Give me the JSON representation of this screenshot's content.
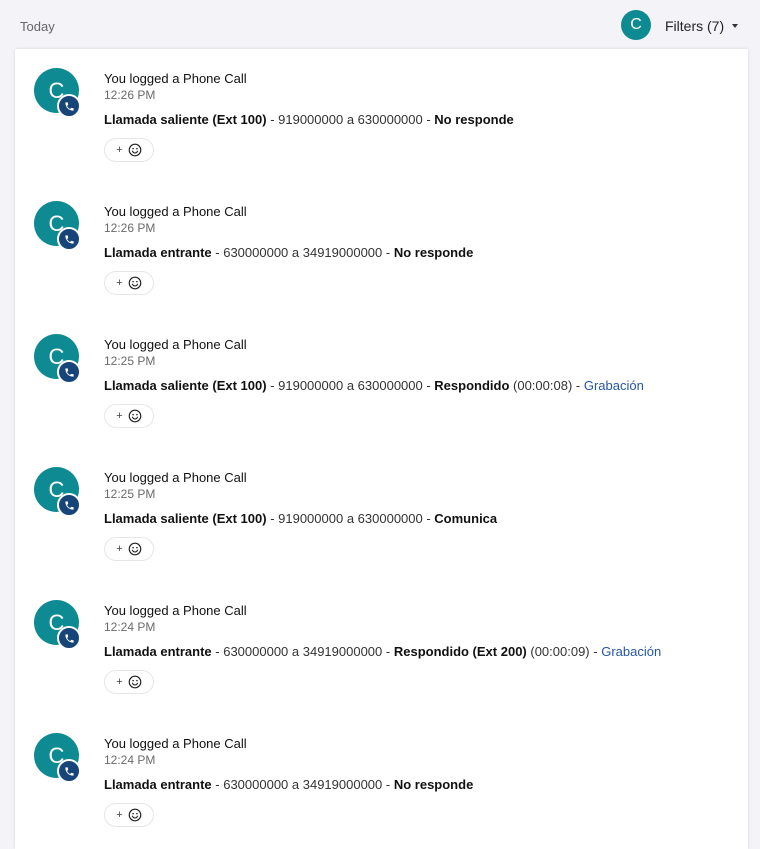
{
  "header": {
    "section_label": "Today",
    "avatar_initial": "C",
    "filters_label": "Filters (7)"
  },
  "colors": {
    "avatar": "#0e8a93",
    "phone_badge": "#17457a",
    "link": "#2456a6",
    "background": "#f4f3f7"
  },
  "icons": {
    "avatar": "avatar-icon",
    "phone": "phone-icon",
    "add": "plus-icon",
    "emoji": "smiley-icon",
    "filters": "caret-down-icon"
  },
  "activities": [
    {
      "avatar_initial": "C",
      "title": "You logged a Phone Call",
      "time": "12:26 PM",
      "call_type": "Llamada saliente (Ext 100)",
      "sep1": " - ",
      "numbers": "919000000 a 630000000",
      "sep2": " - ",
      "status": "No responde",
      "duration": "",
      "sep3": "",
      "recording": "",
      "react_plus": "+"
    },
    {
      "avatar_initial": "C",
      "title": "You logged a Phone Call",
      "time": "12:26 PM",
      "call_type": "Llamada entrante",
      "sep1": " - ",
      "numbers": "630000000 a 34919000000",
      "sep2": " - ",
      "status": "No responde",
      "duration": "",
      "sep3": "",
      "recording": "",
      "react_plus": "+"
    },
    {
      "avatar_initial": "C",
      "title": "You logged a Phone Call",
      "time": "12:25 PM",
      "call_type": "Llamada saliente (Ext 100)",
      "sep1": " - ",
      "numbers": "919000000 a 630000000",
      "sep2": " - ",
      "status": "Respondido",
      "duration": " (00:00:08)",
      "sep3": " - ",
      "recording": "Grabación",
      "react_plus": "+"
    },
    {
      "avatar_initial": "C",
      "title": "You logged a Phone Call",
      "time": "12:25 PM",
      "call_type": "Llamada saliente (Ext 100)",
      "sep1": " - ",
      "numbers": "919000000 a 630000000",
      "sep2": " - ",
      "status": "Comunica",
      "duration": "",
      "sep3": "",
      "recording": "",
      "react_plus": "+"
    },
    {
      "avatar_initial": "C",
      "title": "You logged a Phone Call",
      "time": "12:24 PM",
      "call_type": "Llamada entrante",
      "sep1": " - ",
      "numbers": "630000000 a 34919000000",
      "sep2": " - ",
      "status": "Respondido (Ext 200)",
      "duration": " (00:00:09)",
      "sep3": " - ",
      "recording": "Grabación",
      "react_plus": "+"
    },
    {
      "avatar_initial": "C",
      "title": "You logged a Phone Call",
      "time": "12:24 PM",
      "call_type": "Llamada entrante",
      "sep1": " - ",
      "numbers": "630000000 a 34919000000",
      "sep2": " - ",
      "status": "No responde",
      "duration": "",
      "sep3": "",
      "recording": "",
      "react_plus": "+"
    }
  ]
}
